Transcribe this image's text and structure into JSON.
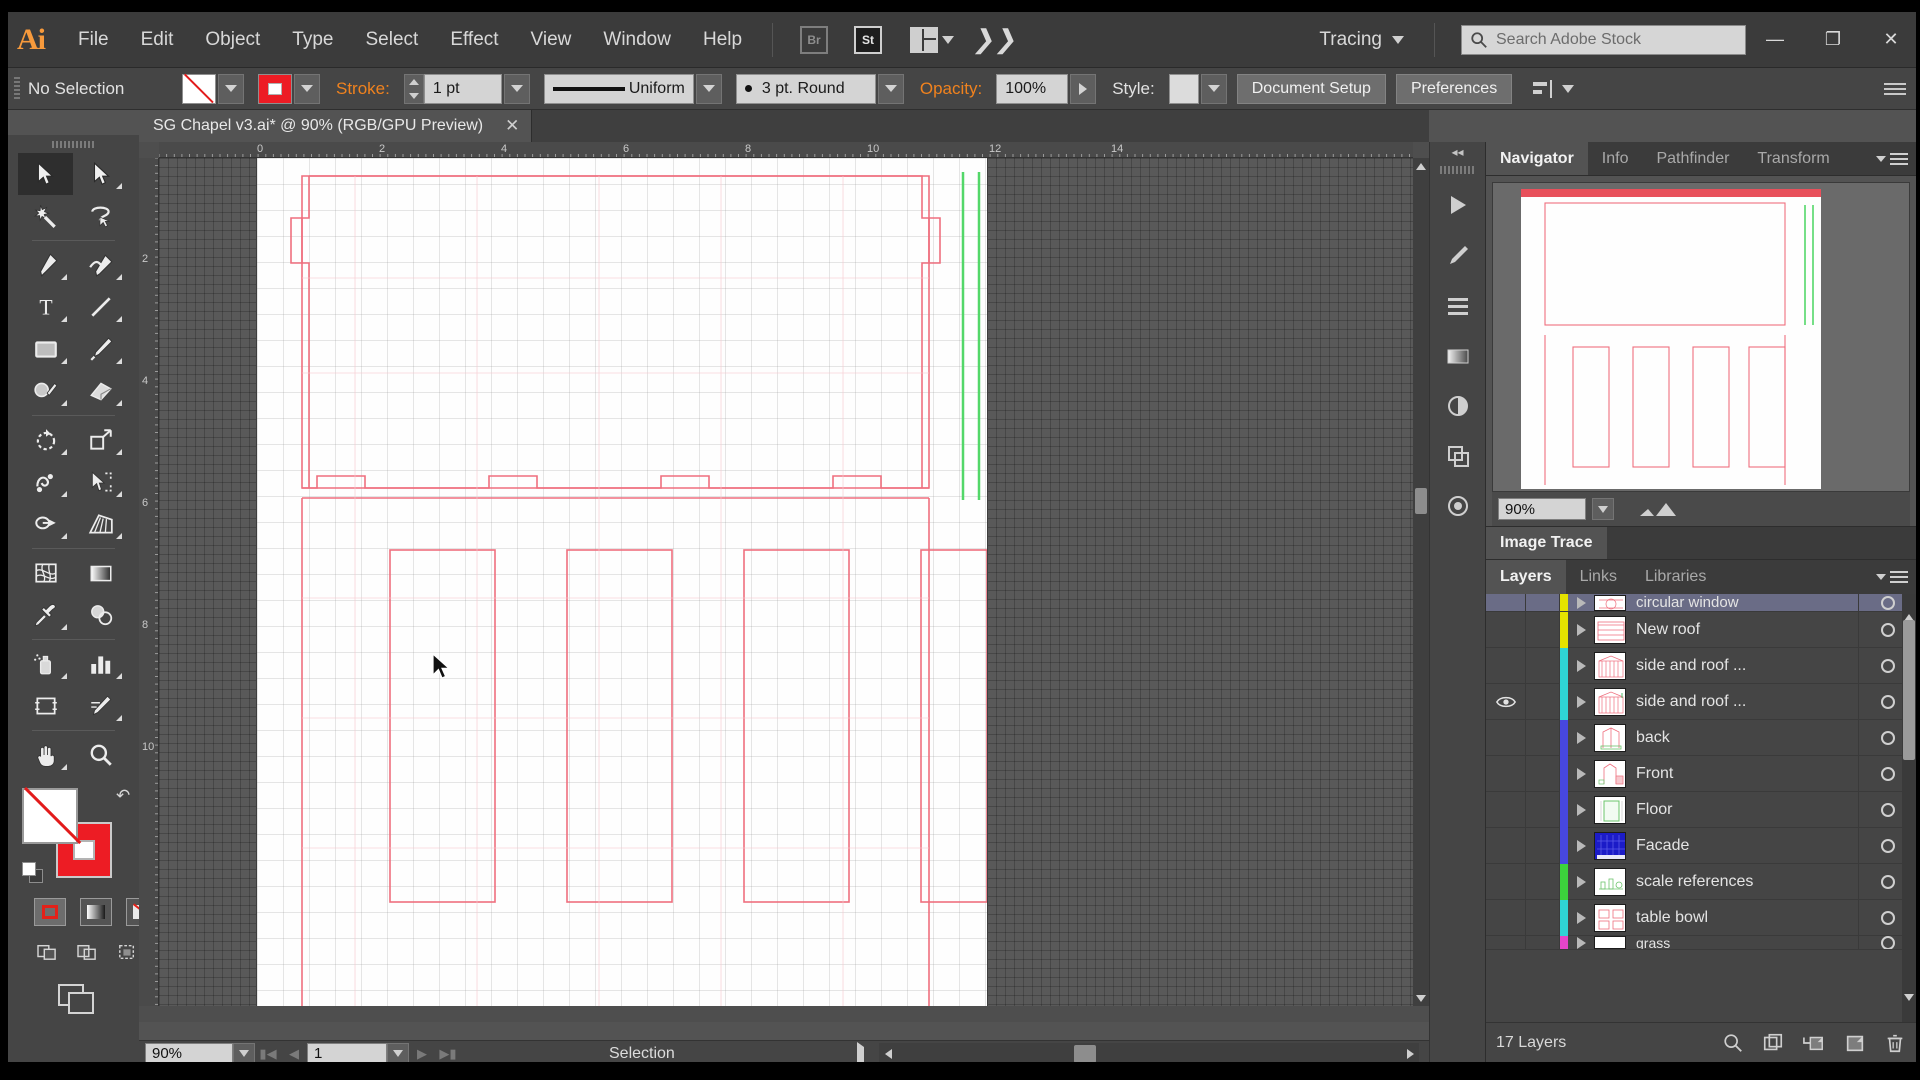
{
  "app": {
    "name": "Adobe Illustrator",
    "logo_text": "Ai"
  },
  "menubar": {
    "items": [
      "File",
      "Edit",
      "Object",
      "Type",
      "Select",
      "Effect",
      "View",
      "Window",
      "Help"
    ],
    "bridge_label": "Br",
    "stock_label": "St",
    "arrange_icon": "arrange-documents-icon",
    "cc_icon": "creative-cloud-icon",
    "workspace": "Tracing",
    "search_placeholder": "Search Adobe Stock",
    "window_minimize": "—",
    "window_maximize": "❐",
    "window_close": "✕"
  },
  "controlbar": {
    "selection_status": "No Selection",
    "fill_label": "fill-swatch",
    "stroke_label": "stroke-swatch",
    "stroke_text": "Stroke:",
    "stroke_weight": "1 pt",
    "stroke_profile": "Uniform",
    "brush_definition": "3 pt. Round",
    "opacity_label": "Opacity:",
    "opacity_value": "100%",
    "style_label": "Style:",
    "document_setup": "Document Setup",
    "preferences": "Preferences"
  },
  "document": {
    "tab_title": "SG Chapel v3.ai* @ 90% (RGB/GPU Preview)",
    "close_glyph": "✕"
  },
  "toolbox": {
    "tools": [
      {
        "name": "selection-tool",
        "active": true,
        "more": false
      },
      {
        "name": "direct-selection-tool",
        "active": false,
        "more": true
      },
      {
        "name": "magic-wand-tool",
        "active": false,
        "more": false
      },
      {
        "name": "lasso-tool",
        "active": false,
        "more": false
      },
      {
        "name": "pen-tool",
        "active": false,
        "more": true
      },
      {
        "name": "curvature-tool",
        "active": false,
        "more": true
      },
      {
        "name": "type-tool",
        "active": false,
        "more": true
      },
      {
        "name": "line-segment-tool",
        "active": false,
        "more": true
      },
      {
        "name": "rectangle-tool",
        "active": false,
        "more": true
      },
      {
        "name": "paintbrush-tool",
        "active": false,
        "more": true
      },
      {
        "name": "shaper-tool",
        "active": false,
        "more": true
      },
      {
        "name": "eraser-tool",
        "active": false,
        "more": true
      },
      {
        "name": "rotate-tool",
        "active": false,
        "more": true
      },
      {
        "name": "scale-tool",
        "active": false,
        "more": true
      },
      {
        "name": "width-tool",
        "active": false,
        "more": true
      },
      {
        "name": "free-transform-tool",
        "active": false,
        "more": true
      },
      {
        "name": "shape-builder-tool",
        "active": false,
        "more": true
      },
      {
        "name": "perspective-grid-tool",
        "active": false,
        "more": true
      },
      {
        "name": "mesh-tool",
        "active": false,
        "more": false
      },
      {
        "name": "gradient-tool",
        "active": false,
        "more": false
      },
      {
        "name": "eyedropper-tool",
        "active": false,
        "more": true
      },
      {
        "name": "blend-tool",
        "active": false,
        "more": false
      },
      {
        "name": "symbol-sprayer-tool",
        "active": false,
        "more": true
      },
      {
        "name": "column-graph-tool",
        "active": false,
        "more": true
      },
      {
        "name": "artboard-tool",
        "active": false,
        "more": false
      },
      {
        "name": "slice-tool",
        "active": false,
        "more": true
      },
      {
        "name": "hand-tool",
        "active": false,
        "more": true
      },
      {
        "name": "zoom-tool",
        "active": false,
        "more": false
      }
    ],
    "fill_color": "#ffffff",
    "stroke_color": "#ed1c24"
  },
  "canvas": {
    "ruler_unit_numbers_h": [
      "0",
      "2",
      "4",
      "6",
      "8",
      "10",
      "12",
      "14"
    ],
    "ruler_unit_numbers_v": [
      "2",
      "4",
      "6",
      "8",
      "10"
    ],
    "artwork_name": "chapel-elevation-drawing",
    "artwork_stroke_color": "#ef6f7e",
    "guide_color": "#53d769"
  },
  "statusbar": {
    "zoom_value": "90%",
    "page_value": "1",
    "status_text": "Selection"
  },
  "panels": {
    "collapse_glyph": "◂◂",
    "top_group_tabs": [
      {
        "label": "Navigator",
        "active": true
      },
      {
        "label": "Info",
        "active": false
      },
      {
        "label": "Pathfinder",
        "active": false
      },
      {
        "label": "Transform",
        "active": false
      }
    ],
    "navigator": {
      "zoom_value": "90%"
    },
    "image_trace_tab": "Image Trace",
    "layers_tabs": [
      {
        "label": "Layers",
        "active": true
      },
      {
        "label": "Links",
        "active": false
      },
      {
        "label": "Libraries",
        "active": false
      }
    ]
  },
  "layers": {
    "count_text": "17 Layers",
    "rows": [
      {
        "name": "circular window",
        "color": "#e5e300",
        "visible": false,
        "selected": true,
        "partial": true
      },
      {
        "name": "New roof",
        "color": "#e5e300",
        "visible": false,
        "selected": false,
        "partial": false
      },
      {
        "name": "side and roof ...",
        "color": "#2fd4d4",
        "visible": false,
        "selected": false,
        "partial": false
      },
      {
        "name": "side and roof ...",
        "color": "#2fd4d4",
        "visible": true,
        "selected": false,
        "partial": false
      },
      {
        "name": "back",
        "color": "#4747e0",
        "visible": false,
        "selected": false,
        "partial": false
      },
      {
        "name": "Front",
        "color": "#4747e0",
        "visible": false,
        "selected": false,
        "partial": false
      },
      {
        "name": "Floor",
        "color": "#4747e0",
        "visible": false,
        "selected": false,
        "partial": false
      },
      {
        "name": "Facade",
        "color": "#4747e0",
        "visible": false,
        "selected": false,
        "partial": false
      },
      {
        "name": "scale references",
        "color": "#3cd13c",
        "visible": false,
        "selected": false,
        "partial": false
      },
      {
        "name": "table bowl",
        "color": "#2fd4d4",
        "visible": false,
        "selected": false,
        "partial": false
      },
      {
        "name": "grass",
        "color": "#e545c8",
        "visible": false,
        "selected": false,
        "partial": true
      }
    ],
    "footer_icons": [
      {
        "name": "locate-object-icon"
      },
      {
        "name": "make-clipping-mask-icon"
      },
      {
        "name": "create-new-sublayer-icon"
      },
      {
        "name": "create-new-layer-icon"
      },
      {
        "name": "delete-selection-icon"
      }
    ]
  },
  "icon_dock": {
    "items": [
      {
        "name": "libraries-dock-icon"
      },
      {
        "name": "brushes-dock-icon"
      },
      {
        "name": "align-dock-icon"
      },
      {
        "name": "gradient-dock-icon"
      },
      {
        "name": "transparency-dock-icon"
      },
      {
        "name": "appearance-dock-icon"
      },
      {
        "name": "graphic-styles-dock-icon"
      }
    ]
  }
}
